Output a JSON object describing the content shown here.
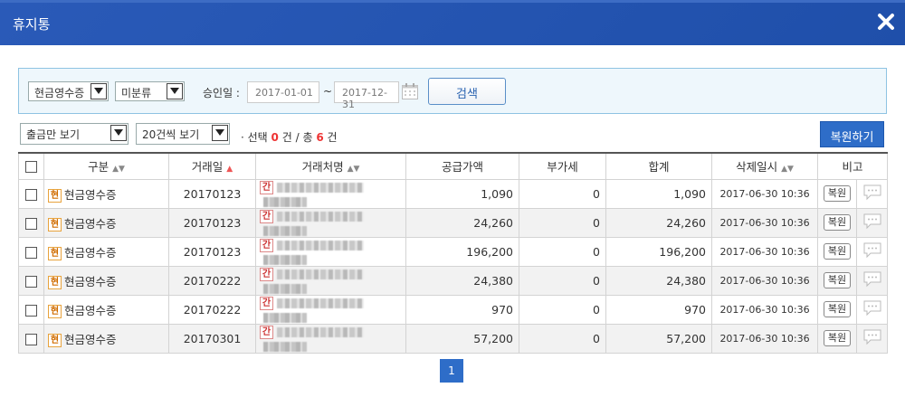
{
  "window": {
    "title": "휴지통"
  },
  "search": {
    "receipt_type": "현금영수증",
    "category": "미분류",
    "date_label": "승인일 :",
    "date_from": "2017-01-01",
    "tilde": "~",
    "date_to": "2017-12-31",
    "button": "검색"
  },
  "toolbar": {
    "filter": "출금만 보기",
    "page_size": "20건씩 보기",
    "info_prefix": "· 선택",
    "selected_count": "0",
    "info_mid": "건 / 총",
    "total_count": "6",
    "info_suffix": "건",
    "restore_button": "복원하기"
  },
  "table": {
    "headers": {
      "type": "구분",
      "date": "거래일",
      "vendor": "거래처명",
      "supply": "공급가액",
      "vat": "부가세",
      "total": "합계",
      "deleted": "삭제일시",
      "note": "비고"
    },
    "type_badge": "현",
    "vendor_badge": "간",
    "restore_label": "복원",
    "rows": [
      {
        "type": "현금영수증",
        "date": "20170123",
        "supply": "1,090",
        "vat": "0",
        "total": "1,090",
        "deleted": "2017-06-30 10:36"
      },
      {
        "type": "현금영수증",
        "date": "20170123",
        "supply": "24,260",
        "vat": "0",
        "total": "24,260",
        "deleted": "2017-06-30 10:36"
      },
      {
        "type": "현금영수증",
        "date": "20170123",
        "supply": "196,200",
        "vat": "0",
        "total": "196,200",
        "deleted": "2017-06-30 10:36"
      },
      {
        "type": "현금영수증",
        "date": "20170222",
        "supply": "24,380",
        "vat": "0",
        "total": "24,380",
        "deleted": "2017-06-30 10:36"
      },
      {
        "type": "현금영수증",
        "date": "20170222",
        "supply": "970",
        "vat": "0",
        "total": "970",
        "deleted": "2017-06-30 10:36"
      },
      {
        "type": "현금영수증",
        "date": "20170301",
        "supply": "57,200",
        "vat": "0",
        "total": "57,200",
        "deleted": "2017-06-30 10:36"
      }
    ]
  },
  "pagination": {
    "current": "1"
  },
  "colors": {
    "title_bar": "#2a5ab8",
    "accent": "#2e6dc8",
    "highlight": "#e33333"
  }
}
